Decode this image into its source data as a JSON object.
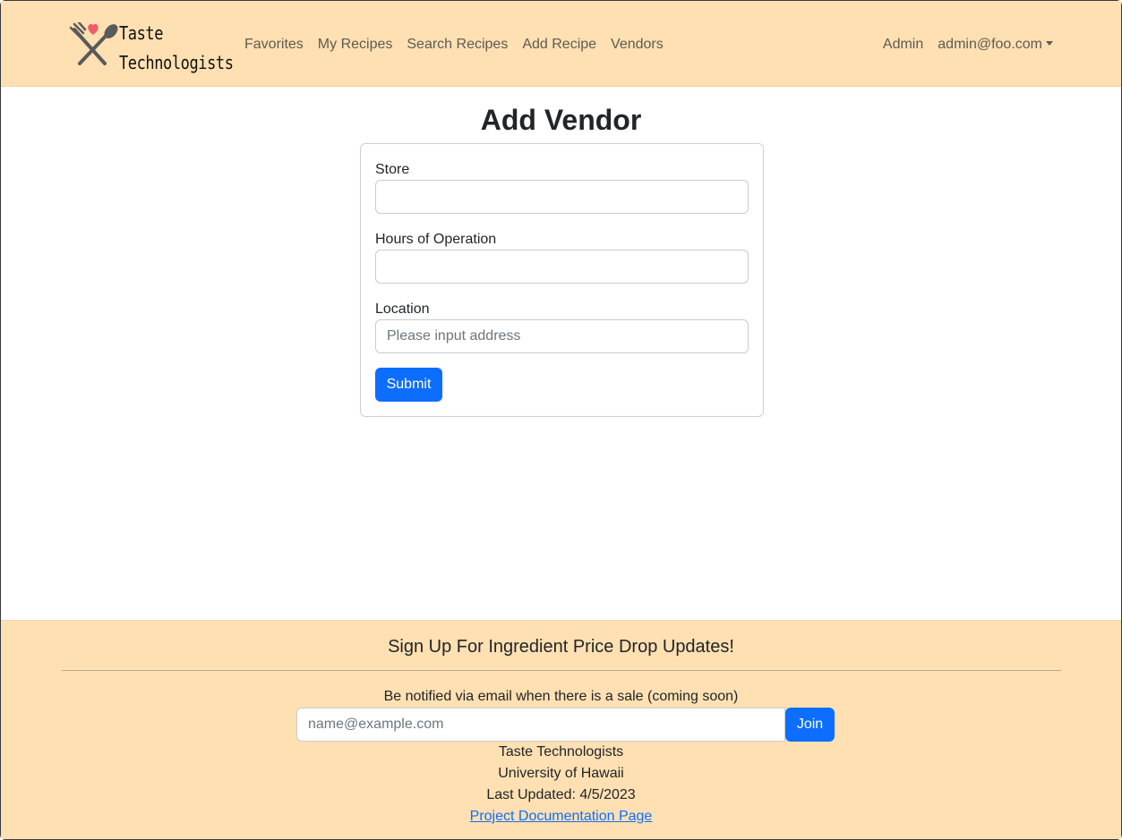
{
  "brand": {
    "line1": "Taste",
    "line2": "Technologists"
  },
  "nav": {
    "links": [
      "Favorites",
      "My Recipes",
      "Search Recipes",
      "Add Recipe",
      "Vendors"
    ],
    "admin": "Admin",
    "user": "admin@foo.com"
  },
  "page": {
    "title": "Add Vendor"
  },
  "form": {
    "store_label": "Store",
    "store_value": "",
    "hours_label": "Hours of Operation",
    "hours_value": "",
    "location_label": "Location",
    "location_placeholder": "Please input address",
    "submit_label": "Submit"
  },
  "footer": {
    "heading": "Sign Up For Ingredient Price Drop Updates!",
    "notice": "Be notified via email when there is a sale (coming soon)",
    "email_placeholder": "name@example.com",
    "join_label": "Join",
    "org": "Taste Technologists",
    "school": "University of Hawaii",
    "updated": "Last Updated: 4/5/2023",
    "doc_link": "Project Documentation Page"
  },
  "colors": {
    "nav_bg": "#ffe0b2",
    "primary": "#0d6efd",
    "heart": "#f25c6a",
    "utensils": "#5a5a5a"
  }
}
